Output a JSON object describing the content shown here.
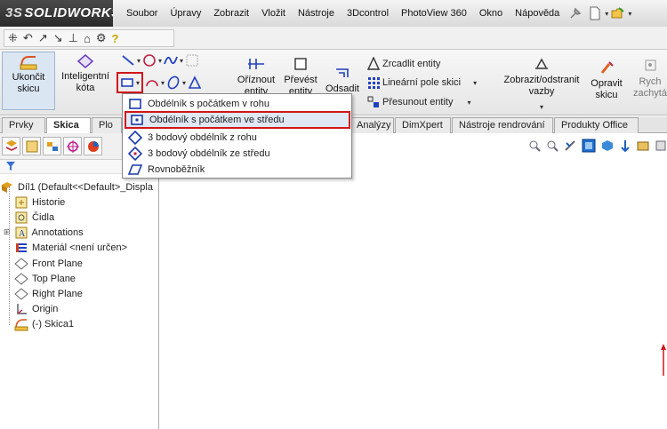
{
  "app": {
    "logo_prefix": "3S",
    "logo_name": "SOLIDWORKS"
  },
  "menu": [
    "Soubor",
    "Úpravy",
    "Zobrazit",
    "Vložit",
    "Nástroje",
    "3Dcontrol",
    "PhotoView 360",
    "Okno",
    "Nápověda"
  ],
  "commands": {
    "exit_sketch": "Ukončit skicu",
    "smart_dimension": "Inteligentní kóta",
    "trim": "Oříznout entity",
    "convert": "Převést entity",
    "offset": "Odsadit",
    "mirror": "Zrcadlit entity",
    "linear_pattern": "Lineární pole skici",
    "move": "Přesunout entity",
    "relations": "Zobrazit/odstranit vazby",
    "repair": "Opravit skicu",
    "rapid": "Rych zachytá"
  },
  "tabs": [
    "Prvky",
    "Skica",
    "Plo",
    "Analýzy",
    "DimXpert",
    "Nástroje rendrování",
    "Produkty Office"
  ],
  "dropdown": [
    {
      "label": "Obdélník s počátkem v rohu",
      "icon": "rect-corner-icon"
    },
    {
      "label": "Obdélník s počátkem ve středu",
      "icon": "rect-center-icon"
    },
    {
      "label": "3 bodový obdélník z rohu",
      "icon": "rect-3pt-corner-icon"
    },
    {
      "label": "3 bodový obdélník ze středu",
      "icon": "rect-3pt-center-icon"
    },
    {
      "label": "Rovnoběžník",
      "icon": "parallelogram-icon"
    }
  ],
  "tree": {
    "root": "Díl1  (Default<<Default>_Displa",
    "items": [
      "Historie",
      "Čidla",
      "Annotations",
      "Materiál <není určen>",
      "Front Plane",
      "Top Plane",
      "Right Plane",
      "Origin",
      "(-) Skica1"
    ]
  },
  "colors": {
    "accent_red": "#d0161b",
    "highlight": "#dfe8f4"
  }
}
